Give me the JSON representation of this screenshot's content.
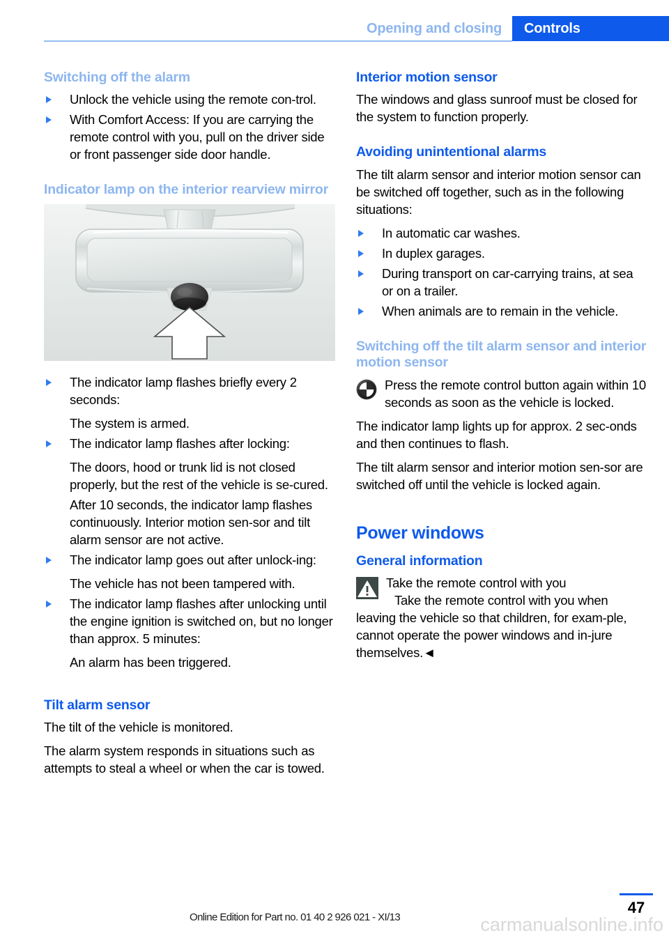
{
  "header": {
    "chapter": "Opening and closing",
    "tab": "Controls"
  },
  "left_column": {
    "heading_switching_off": "Switching off the alarm",
    "bullets_switching_off": [
      "Unlock the vehicle using the remote con‑trol.",
      "With Comfort Access: If you are carrying the remote control with you, pull on the driver side or front passenger side door handle."
    ],
    "heading_indicator_lamp": "Indicator lamp on the interior rearview mirror",
    "figure_alt": "Interior rearview mirror with indicator lamp and upward pointing arrow",
    "indicator_items": [
      {
        "bullet": "The indicator lamp flashes briefly every 2 seconds:",
        "paras": [
          "The system is armed."
        ]
      },
      {
        "bullet": "The indicator lamp flashes after locking:",
        "paras": [
          "The doors, hood or trunk lid is not closed properly, but the rest of the vehicle is se‑cured.",
          "After 10 seconds, the indicator lamp flashes continuously. Interior motion sen‑sor and tilt alarm sensor are not active."
        ]
      },
      {
        "bullet": "The indicator lamp goes out after unlock‑ing:",
        "paras": [
          "The vehicle has not been tampered with."
        ]
      },
      {
        "bullet": "The indicator lamp flashes after unlocking until the engine ignition is switched on, but no longer than approx. 5 minutes:",
        "paras": [
          "An alarm has been triggered."
        ]
      }
    ],
    "heading_tilt_alarm": "Tilt alarm sensor",
    "tilt_paras": [
      "The tilt of the vehicle is monitored.",
      "The alarm system responds in situations such as attempts to steal a wheel or when the car is towed."
    ]
  },
  "right_column": {
    "heading_interior_motion": "Interior motion sensor",
    "interior_motion_para": "The windows and glass sunroof must be closed for the system to function properly.",
    "heading_avoiding": "Avoiding unintentional alarms",
    "avoiding_intro": "The tilt alarm sensor and interior motion sensor can be switched off together, such as in the following situations:",
    "avoiding_bullets": [
      "In automatic car washes.",
      "In duplex garages.",
      "During transport on car-carrying trains, at sea or on a trailer.",
      "When animals are to remain in the vehicle."
    ],
    "heading_switching_off_sensors": "Switching off the tilt alarm sensor and interior motion sensor",
    "bmw_note": "Press the remote control button again within 10 seconds as soon as the vehicle is locked.",
    "sensor_paras": [
      "The indicator lamp lights up for approx. 2 sec‑onds and then continues to flash.",
      "The tilt alarm sensor and interior motion sen‑sor are switched off until the vehicle is locked again."
    ],
    "heading_power_windows": "Power windows",
    "heading_general_info": "General information",
    "warning_title": "Take the remote control with you",
    "warning_body": "Take the remote control with you when leaving the vehicle so that children, for exam‑ple, cannot operate the power windows and in‑jure themselves.◄"
  },
  "footer": {
    "edition": "Online Edition for Part no. 01 40 2 926 021 - XI/13",
    "page_number": "47",
    "watermark": "carmanualsonline.info"
  },
  "icons": {
    "bullet": "triangle-right-icon",
    "bmw": "bmw-roundel-icon",
    "warning": "warning-triangle-icon"
  },
  "colors": {
    "accent_blue": "#0d5aeb",
    "light_blue": "#8db6ef",
    "bullet_blue": "#2f7bf0",
    "warning_box": "#3c4846"
  }
}
